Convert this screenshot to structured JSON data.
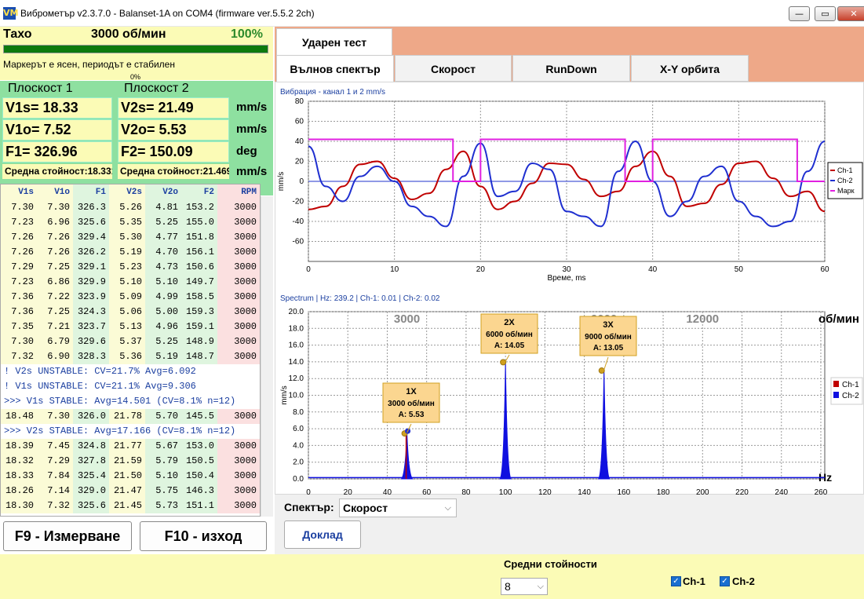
{
  "window": {
    "title": "Виброметър v2.3.7.0 - Balanset-1A on COM4 (firmware ver.5.5.2 2ch)",
    "icon": "VM",
    "minimize": "—",
    "maximize": "▭",
    "close": "✕"
  },
  "tacho": {
    "label": "Тахо",
    "rpm": "3000 об/мин",
    "percent": "100%",
    "progress": 1.0,
    "marker": "Маркерът е ясен, периодът е стабилен",
    "marker_pct": "0%"
  },
  "plane1": {
    "title": "Плоскост 1",
    "v1s": "V1s= 18.33",
    "v1o": "V1o= 7.52",
    "f1": "F1= 326.96",
    "avg": "Средна стойност:18.331"
  },
  "plane2": {
    "title": "Плоскост 2",
    "v2s": "V2s= 21.49",
    "v2o": "V2o= 5.53",
    "f2": "F2= 150.09",
    "avg": "Средна стойност:21.469"
  },
  "units": {
    "u1": "mm/s",
    "u2": "mm/s",
    "u3": "deg",
    "u4": "mm/s"
  },
  "table": {
    "headers": [
      "V1s",
      "V1o",
      "F1",
      "V2s",
      "V2o",
      "F2",
      "RPM"
    ],
    "rows": [
      [
        "7.30",
        "7.30",
        "326.3",
        "5.26",
        "4.81",
        "153.2",
        "3000"
      ],
      [
        "7.23",
        "6.96",
        "325.6",
        "5.35",
        "5.25",
        "155.0",
        "3000"
      ],
      [
        "7.26",
        "7.26",
        "329.4",
        "5.30",
        "4.77",
        "151.8",
        "3000"
      ],
      [
        "7.26",
        "7.26",
        "326.2",
        "5.19",
        "4.70",
        "156.1",
        "3000"
      ],
      [
        "7.29",
        "7.25",
        "329.1",
        "5.23",
        "4.73",
        "150.6",
        "3000"
      ],
      [
        "7.23",
        "6.86",
        "329.9",
        "5.10",
        "5.10",
        "149.7",
        "3000"
      ],
      [
        "7.36",
        "7.22",
        "323.9",
        "5.09",
        "4.99",
        "158.5",
        "3000"
      ],
      [
        "7.36",
        "7.25",
        "324.3",
        "5.06",
        "5.00",
        "159.3",
        "3000"
      ],
      [
        "7.35",
        "7.21",
        "323.7",
        "5.13",
        "4.96",
        "159.1",
        "3000"
      ],
      [
        "7.30",
        "6.79",
        "329.6",
        "5.37",
        "5.25",
        "148.9",
        "3000"
      ],
      [
        "7.32",
        "6.90",
        "328.3",
        "5.36",
        "5.19",
        "148.7",
        "3000"
      ]
    ],
    "messages": [
      "! V2s UNSTABLE: CV=21.7% Avg=6.092",
      "! V1s UNSTABLE: CV=21.1% Avg=9.306",
      ">>> V1s STABLE: Avg=14.501 (CV=8.1% n=12)"
    ],
    "mid_row": [
      "18.48",
      "7.30",
      "326.0",
      "21.78",
      "5.70",
      "145.5",
      "3000"
    ],
    "message_last": ">>> V2s STABLE: Avg=17.166 (CV=8.1% n=12)",
    "rows2": [
      [
        "18.39",
        "7.45",
        "324.8",
        "21.77",
        "5.67",
        "153.0",
        "3000"
      ],
      [
        "18.32",
        "7.29",
        "327.8",
        "21.59",
        "5.79",
        "150.5",
        "3000"
      ],
      [
        "18.33",
        "7.84",
        "325.4",
        "21.50",
        "5.10",
        "150.4",
        "3000"
      ],
      [
        "18.26",
        "7.14",
        "329.0",
        "21.47",
        "5.75",
        "146.3",
        "3000"
      ],
      [
        "18.30",
        "7.32",
        "325.6",
        "21.45",
        "5.73",
        "151.1",
        "3000"
      ]
    ]
  },
  "buttons": {
    "f9": "F9 - Измерване",
    "f10": "F10 - изход",
    "report": "Доклад"
  },
  "tabs": {
    "top": "Ударен тест",
    "row": [
      "Вълнов спектър",
      "Скорост",
      "RunDown",
      "X-Y орбита"
    ],
    "active": "Вълнов спектър"
  },
  "spectrum_select": {
    "label": "Спектър:",
    "value": "Скорост"
  },
  "bottom": {
    "avg_label": "Средни стойности",
    "avg_value": "8",
    "ch1": "Ch-1",
    "ch2": "Ch-2"
  },
  "colors": {
    "ch1": "#c00000",
    "ch2": "#1f2fd0",
    "marker": "#e020e0",
    "spec2": "#1010e0"
  },
  "chart_data": [
    {
      "type": "line",
      "title": "Вибрация  - канал 1 и 2 mm/s",
      "xlabel": "Време, ms",
      "ylabel": "mm/s",
      "xlim": [
        0,
        60
      ],
      "ylim": [
        -80,
        80
      ],
      "xticks": [
        0,
        10,
        20,
        30,
        40,
        50,
        60
      ],
      "yticks": [
        -60,
        -40,
        -20,
        0,
        20,
        40,
        60,
        80
      ],
      "legend": [
        "Ch-1",
        "Ch-2",
        "Марк"
      ],
      "legend_position": "right",
      "series": [
        {
          "name": "Ch-1",
          "x": [
            0,
            2,
            4,
            6,
            8,
            10,
            12,
            14,
            16,
            18,
            20,
            22,
            24,
            26,
            28,
            30,
            32,
            34,
            36,
            38,
            40,
            42,
            44,
            46,
            48,
            50,
            52,
            54,
            56,
            58,
            60
          ],
          "y": [
            -28,
            -25,
            -5,
            17,
            20,
            3,
            -18,
            -12,
            12,
            30,
            -5,
            -28,
            -20,
            -2,
            18,
            17,
            2,
            -15,
            -10,
            15,
            30,
            5,
            -25,
            -22,
            -3,
            18,
            20,
            3,
            -15,
            -10,
            -30
          ]
        },
        {
          "name": "Ch-2",
          "x": [
            0,
            2,
            4,
            6,
            8,
            10,
            12,
            14,
            16,
            18,
            20,
            22,
            24,
            26,
            28,
            30,
            32,
            34,
            36,
            38,
            40,
            42,
            44,
            46,
            48,
            50,
            52,
            54,
            56,
            58,
            60
          ],
          "y": [
            35,
            -5,
            -20,
            5,
            15,
            0,
            -25,
            -35,
            -45,
            5,
            38,
            -15,
            -10,
            18,
            12,
            -30,
            -35,
            -45,
            10,
            40,
            0,
            -35,
            -20,
            5,
            15,
            -20,
            -35,
            -45,
            -40,
            10,
            40
          ]
        },
        {
          "name": "Марк",
          "x": [
            0,
            16.8,
            16.8,
            20,
            20,
            36.8,
            36.8,
            40,
            40,
            56.8,
            56.8,
            60
          ],
          "y": [
            42,
            42,
            0,
            0,
            42,
            42,
            0,
            0,
            42,
            42,
            0,
            0
          ]
        }
      ]
    },
    {
      "type": "line",
      "title": "Spectrum | Hz: 239.2 | Ch-1: 0.01 | Ch-2: 0.02",
      "xlabel": "Hz",
      "ylabel": "mm/s",
      "xlim": [
        0,
        262
      ],
      "ylim": [
        0,
        20
      ],
      "xticks": [
        0,
        20,
        40,
        60,
        80,
        100,
        120,
        140,
        160,
        180,
        200,
        220,
        240,
        260
      ],
      "yticks": [
        0.0,
        2.0,
        4.0,
        6.0,
        8.0,
        10.0,
        12.0,
        14.0,
        16.0,
        18.0,
        20.0
      ],
      "rpm_ticks": [
        "3000",
        "6000",
        "9000",
        "12000"
      ],
      "rpm_unit": "об/мин",
      "legend": [
        "Ch-1",
        "Ch-2"
      ],
      "legend_position": "right",
      "annotations": [
        {
          "label": "1X",
          "rpm": "3000 об/мин",
          "amp": "A: 5.53",
          "x": 50,
          "y": 5.53
        },
        {
          "label": "2X",
          "rpm": "6000 об/мин",
          "amp": "A: 14.05",
          "x": 100,
          "y": 14.05
        },
        {
          "label": "3X",
          "rpm": "9000 об/мин",
          "amp": "A: 13.05",
          "x": 150,
          "y": 13.05
        }
      ],
      "series": [
        {
          "name": "Ch-1",
          "x": [
            50
          ],
          "y": [
            5.9
          ]
        },
        {
          "name": "Ch-2",
          "x": [
            50,
            100,
            150
          ],
          "y": [
            5.53,
            14.05,
            13.05
          ]
        }
      ]
    }
  ]
}
